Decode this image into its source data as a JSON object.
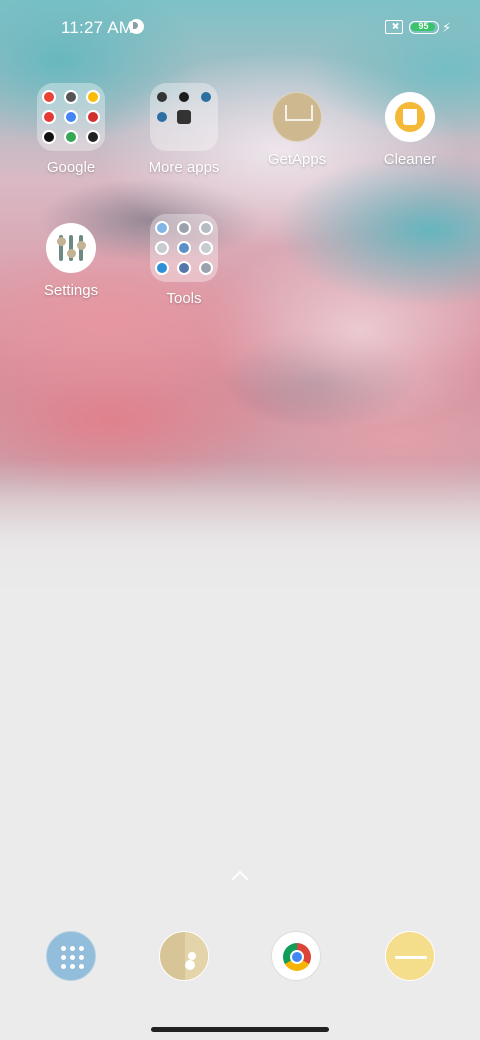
{
  "status_bar": {
    "time": "11:27 AM",
    "battery_level": "95",
    "battery_fraction": 0.95,
    "battery_color": "#39c46a",
    "icons": [
      "notification-icon",
      "no-sim-icon",
      "battery-icon",
      "charging-icon"
    ]
  },
  "home": {
    "apps": [
      {
        "label": "Google",
        "type": "folder"
      },
      {
        "label": "More apps",
        "type": "folder"
      },
      {
        "label": "GetApps",
        "type": "app"
      },
      {
        "label": "Cleaner",
        "type": "app"
      },
      {
        "label": "Settings",
        "type": "app"
      },
      {
        "label": "Tools",
        "type": "folder"
      }
    ],
    "google_folder_icon_colors": [
      "#ea4335",
      "#555555",
      "#fbbc05",
      "#e53935",
      "#4285f4",
      "#d32f2f",
      "#111111",
      "#34a853",
      "#222222"
    ],
    "tools_folder_icon_colors": [
      "#7fb6e6",
      "#9aa3ad",
      "#b6bcc3",
      "#c7ccd1",
      "#5a8fc7",
      "#c7ccd1",
      "#2e8fd6",
      "#5577aa",
      "#9aa3ad"
    ]
  },
  "dock": {
    "items": [
      "app-drawer-icon",
      "contacts-icon",
      "chrome-icon",
      "notes-icon"
    ]
  }
}
